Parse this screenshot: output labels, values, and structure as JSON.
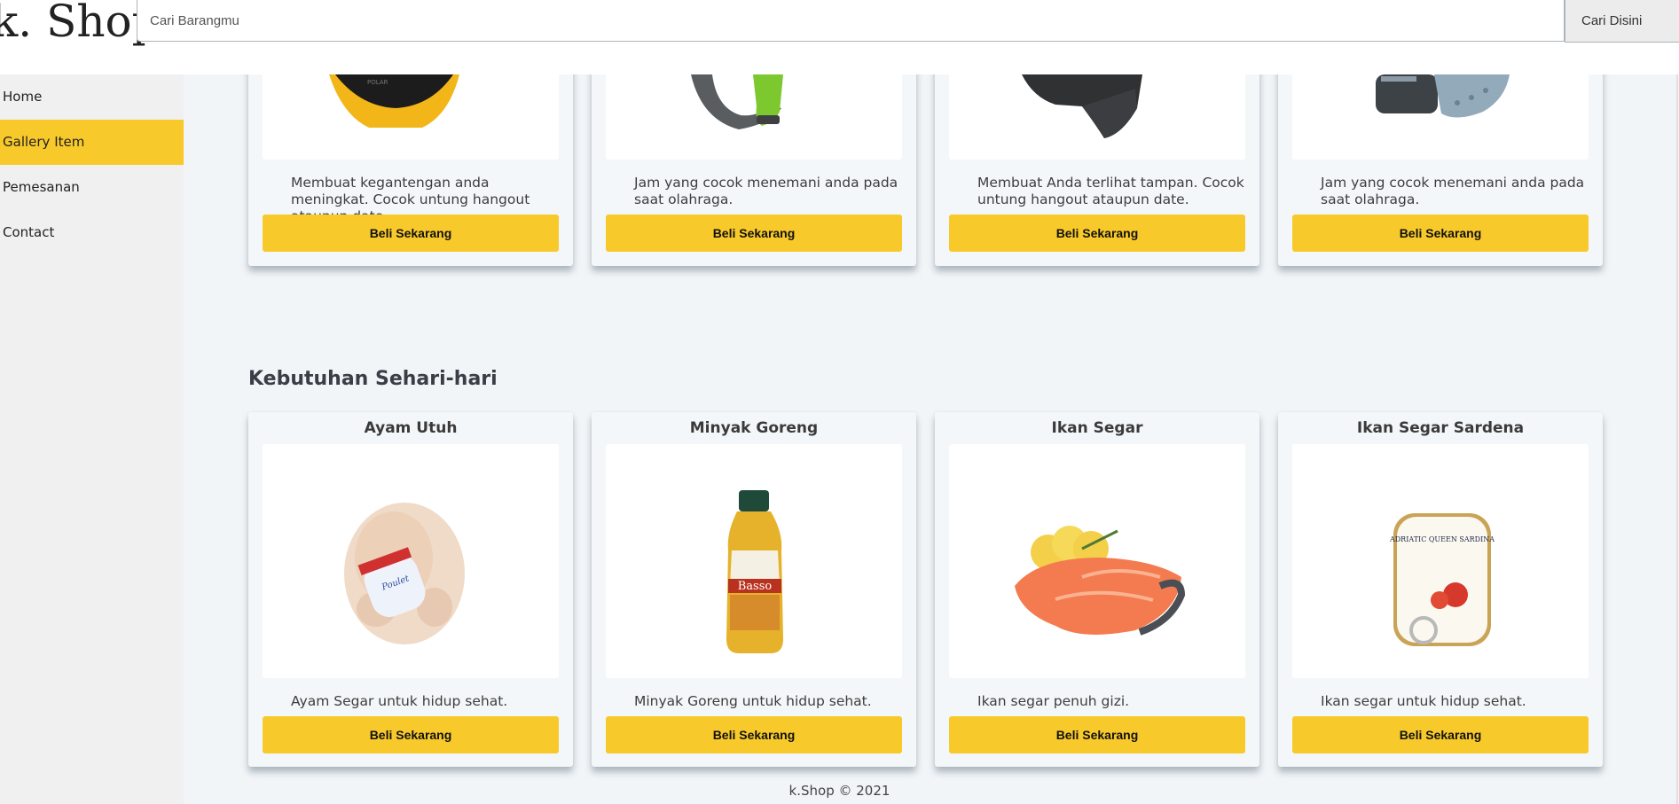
{
  "brand": {
    "logo_text": "k. Shop"
  },
  "search": {
    "placeholder": "Cari Barangmu",
    "button_label": "Cari Disini"
  },
  "sidebar": {
    "items": [
      {
        "label": "Home",
        "active": false
      },
      {
        "label": "Gallery Item",
        "active": true
      },
      {
        "label": "Pemesanan",
        "active": false
      },
      {
        "label": "Contact",
        "active": false
      }
    ]
  },
  "top_products": [
    {
      "description": "Membuat kegantengan anda meningkat. Cocok untung hangout ataupun date.",
      "button": "Beli Sekarang",
      "image_icon": "yellow-watch-icon"
    },
    {
      "description": "Jam yang cocok menemani anda pada saat olahraga.",
      "button": "Beli Sekarang",
      "image_icon": "green-sport-band-icon"
    },
    {
      "description": "Membuat Anda terlihat tampan. Cocok untung hangout ataupun date.",
      "button": "Beli Sekarang",
      "image_icon": "black-mesh-watch-icon"
    },
    {
      "description": "Jam yang cocok menemani anda pada saat olahraga.",
      "button": "Beli Sekarang",
      "image_icon": "grey-fitness-band-icon"
    }
  ],
  "section": {
    "title": "Kebutuhan Sehari-hari"
  },
  "daily_products": [
    {
      "name": "Ayam Utuh",
      "description": "Ayam Segar untuk hidup sehat.",
      "button": "Beli Sekarang",
      "image_icon": "whole-chicken-icon",
      "image_label": "Poulet"
    },
    {
      "name": "Minyak Goreng",
      "description": "Minyak Goreng untuk hidup sehat.",
      "button": "Beli Sekarang",
      "image_icon": "oil-bottle-icon",
      "image_label": "Basso"
    },
    {
      "name": "Ikan Segar",
      "description": "Ikan segar penuh gizi.",
      "button": "Beli Sekarang",
      "image_icon": "salmon-steak-icon"
    },
    {
      "name": "Ikan Segar Sardena",
      "description": "Ikan segar untuk hidup sehat.",
      "button": "Beli Sekarang",
      "image_icon": "sardine-can-icon",
      "image_label": "ADRIATIC QUEEN SARDINA"
    }
  ],
  "footer": {
    "text": "k.Shop © 2021"
  },
  "colors": {
    "accent": "#f8c92a",
    "background": "#f2f5f8",
    "sidebar": "#f0f0f0"
  }
}
